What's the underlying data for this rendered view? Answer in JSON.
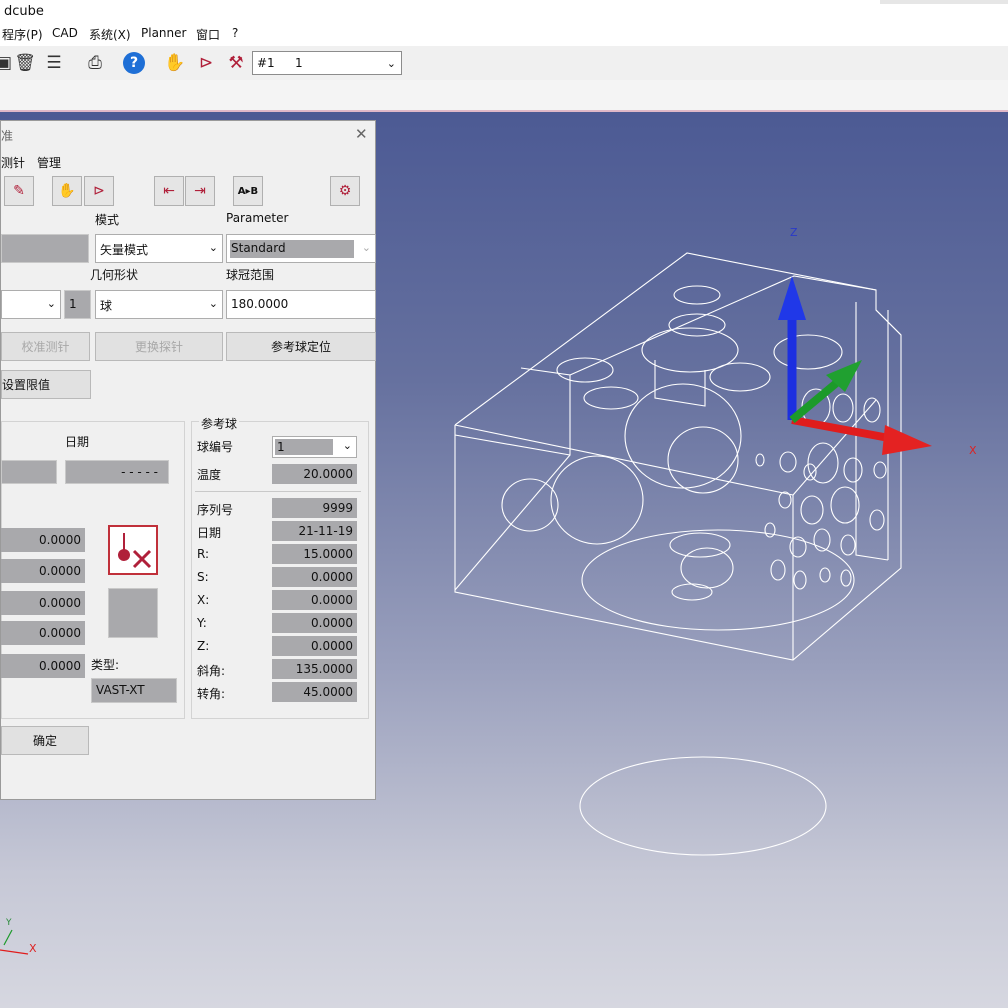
{
  "window": {
    "title": "dcube"
  },
  "menu": [
    "程序(P)",
    "CAD",
    "系统(X)",
    "Planner",
    "窗口",
    "?"
  ],
  "toolbar": {
    "icons": [
      "save-icon",
      "delete-icon",
      "list-icon",
      "print-icon",
      "help-icon",
      "probe-hand-icon",
      "probe-angle-icon",
      "probe-tool-icon"
    ],
    "probe_combo": {
      "prefix": "#1",
      "value": "1"
    }
  },
  "dialog": {
    "title": "准",
    "menu": [
      "测针",
      "管理"
    ],
    "headers": {
      "mode": "模式",
      "parameter": "Parameter",
      "geometry": "几何形状",
      "crown_range": "球冠范围"
    },
    "mode_value": "矢量模式",
    "parameter_value": "Standard",
    "geometry_count": "1",
    "geometry_value": "球",
    "crown_range_value": "180.0000",
    "buttons": {
      "calibrate": "校准测针",
      "change_probe": "更换探针",
      "ref_sphere_locate": "参考球定位",
      "set_limits": "设置限值",
      "ok": "确定"
    },
    "date_label": "日期",
    "date_value": "- - - - -",
    "left_values": [
      "0.0000",
      "0.0000",
      "0.0000",
      "0.0000",
      "0.0000"
    ],
    "type_label": "类型:",
    "type_value": "VAST-XT",
    "ref_sphere": {
      "title": "参考球",
      "ball_no_label": "球编号",
      "ball_no_value": "1",
      "temp_label": "温度",
      "temp_value": "20.0000",
      "rows": [
        {
          "label": "序列号",
          "value": "9999"
        },
        {
          "label": "日期",
          "value": "21-11-19"
        },
        {
          "label": "R:",
          "value": "15.0000"
        },
        {
          "label": "S:",
          "value": "0.0000"
        },
        {
          "label": "X:",
          "value": "0.0000"
        },
        {
          "label": "Y:",
          "value": "0.0000"
        },
        {
          "label": "Z:",
          "value": "0.0000"
        },
        {
          "label": "斜角:",
          "value": "135.0000"
        },
        {
          "label": "转角:",
          "value": "45.0000"
        }
      ]
    }
  },
  "viewport": {
    "axis_z": "Z",
    "axis_x": "X",
    "corner_x": "X",
    "corner_y": "Y"
  },
  "colors": {
    "bg_top": "#4c5a94",
    "bg_bottom": "#d6d7e0",
    "x_axis": "#e01c1c",
    "y_axis": "#1c9a2a",
    "z_axis": "#1c2fe0"
  }
}
